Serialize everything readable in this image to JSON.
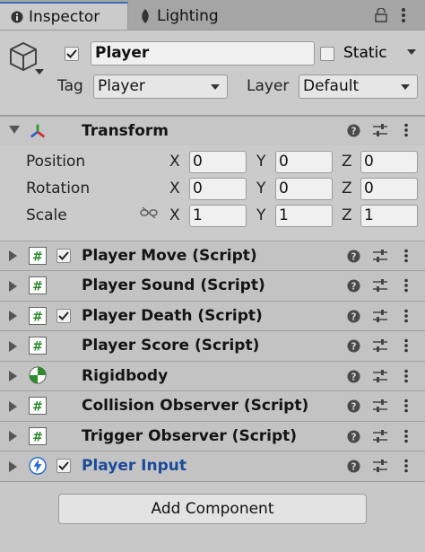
{
  "tabs": [
    {
      "label": "Inspector",
      "icon": "info-icon",
      "active": true
    },
    {
      "label": "Lighting",
      "icon": "eye-icon",
      "active": false
    }
  ],
  "header": {
    "name": "Player",
    "active": true,
    "static_label": "Static",
    "static_checked": false,
    "tag_label": "Tag",
    "tag_value": "Player",
    "layer_label": "Layer",
    "layer_value": "Default"
  },
  "transform": {
    "title": "Transform",
    "rows": [
      {
        "label": "Position",
        "x": "0",
        "y": "0",
        "z": "0"
      },
      {
        "label": "Rotation",
        "x": "0",
        "y": "0",
        "z": "0"
      },
      {
        "label": "Scale",
        "x": "1",
        "y": "1",
        "z": "1"
      }
    ],
    "axes": [
      "X",
      "Y",
      "Z"
    ]
  },
  "components": [
    {
      "title": "Player Move (Script)",
      "icon": "script-icon",
      "checkbox": true,
      "checked": true
    },
    {
      "title": "Player Sound (Script)",
      "icon": "script-icon",
      "checkbox": false
    },
    {
      "title": "Player Death (Script)",
      "icon": "script-icon",
      "checkbox": true,
      "checked": true
    },
    {
      "title": "Player Score (Script)",
      "icon": "script-icon",
      "checkbox": false
    },
    {
      "title": "Rigidbody",
      "icon": "rigidbody-icon",
      "checkbox": false
    },
    {
      "title": "Collision Observer (Script)",
      "icon": "script-icon",
      "checkbox": false
    },
    {
      "title": "Trigger Observer (Script)",
      "icon": "script-icon",
      "checkbox": false
    },
    {
      "title": "Player Input",
      "icon": "input-icon",
      "checkbox": true,
      "checked": true
    }
  ],
  "add_component_label": "Add Component",
  "colors": {
    "accent": "#3a72b0",
    "player_input_title": "#1a4a9a",
    "panel": "#cbcbcb"
  }
}
